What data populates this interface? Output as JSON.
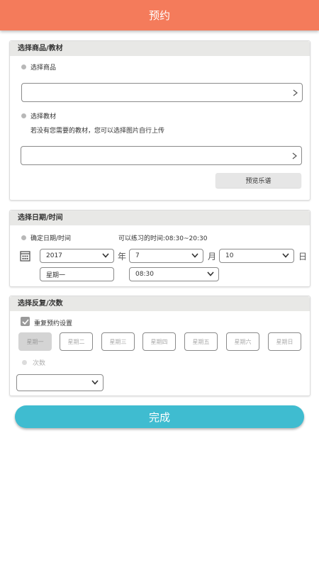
{
  "header": {
    "title": "预约"
  },
  "section1": {
    "title": "选择商品/教材",
    "product_radio_label": "选择商品",
    "material_radio_label": "选择教材",
    "hint": "若没有您需要的教材，您可以选择图片自行上传",
    "preview_button": "预览乐谱"
  },
  "section2": {
    "title": "选择日期/时间",
    "confirm_radio_label": "确定日期/时间",
    "available_time": "可以练习的时间:08:30~20:30",
    "year_value": "2017",
    "year_unit": "年",
    "month_value": "7",
    "month_unit": "月",
    "day_value": "10",
    "day_unit": "日",
    "weekday_value": "星期一",
    "time_value": "08:30"
  },
  "section3": {
    "title": "选择反复/次数",
    "repeat_label": "重复预约设置",
    "weekdays": [
      "星期一",
      "星期二",
      "星期三",
      "星期四",
      "星期五",
      "星期六",
      "星期日"
    ],
    "count_radio_label": "次数",
    "count_value": ""
  },
  "footer": {
    "done_label": "完成"
  },
  "colors": {
    "header": "#f47b5b",
    "done_button": "#3fbcd0"
  }
}
